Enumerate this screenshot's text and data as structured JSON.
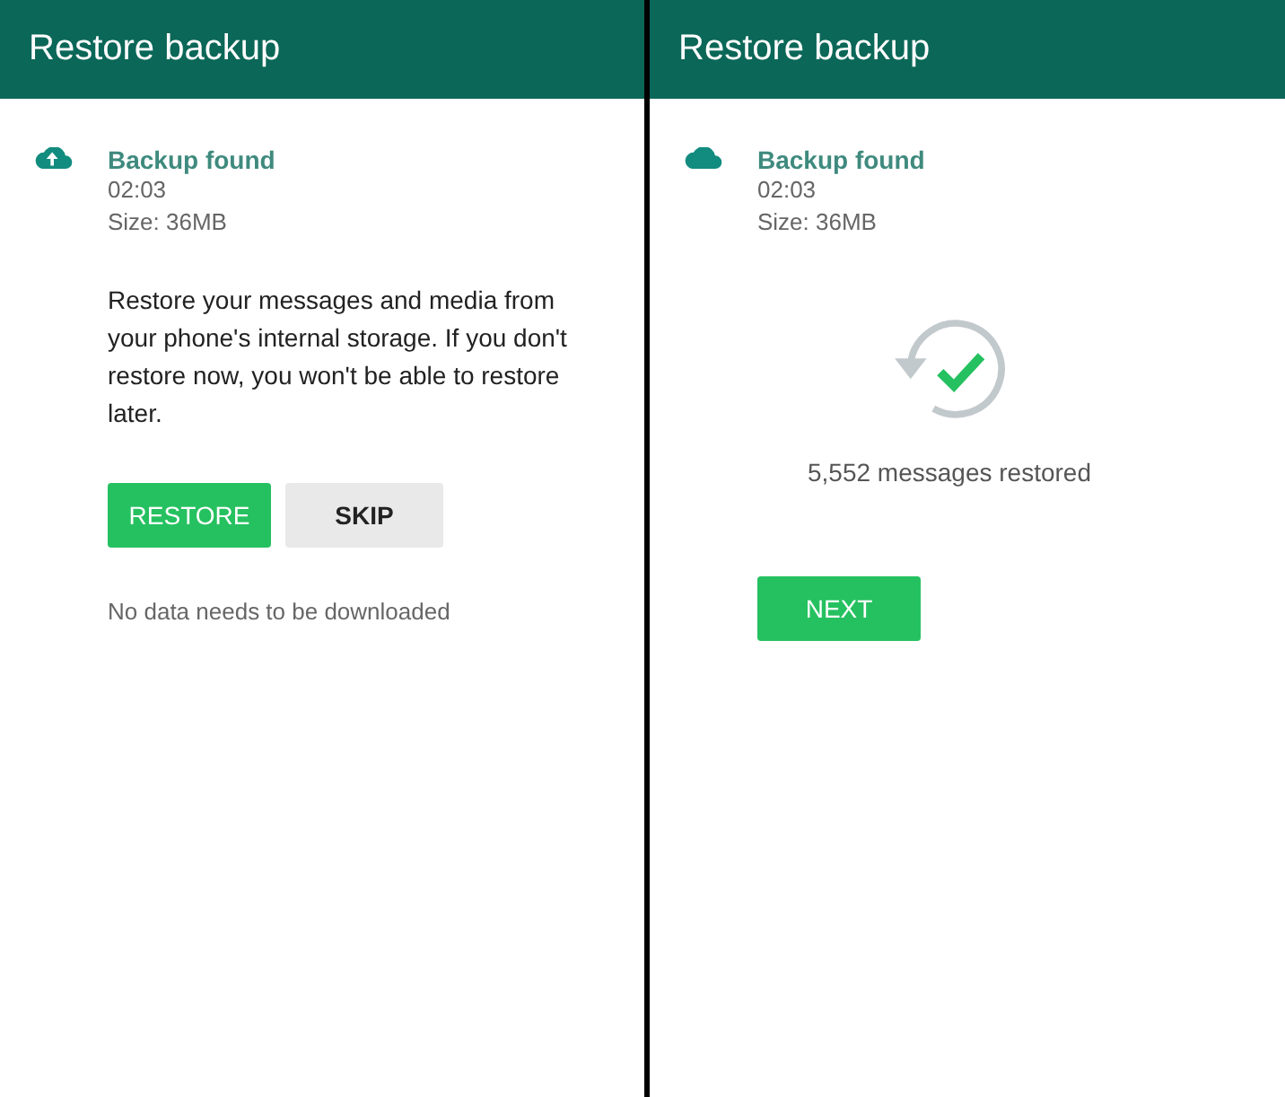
{
  "screens": [
    {
      "title": "Restore backup",
      "backup": {
        "heading": "Backup found",
        "time": "02:03",
        "size": "Size: 36MB",
        "cloud_arrow": true
      },
      "message": "Restore your messages and media from your phone's internal storage. If you don't restore now, you won't be able to restore later.",
      "buttons": [
        {
          "label": "RESTORE",
          "kind": "primary"
        },
        {
          "label": "SKIP",
          "kind": "secondary"
        }
      ],
      "note": "No data needs to be downloaded"
    },
    {
      "title": "Restore backup",
      "backup": {
        "heading": "Backup found",
        "time": "02:03",
        "size": "Size: 36MB",
        "cloud_arrow": false
      },
      "status": "5,552 messages restored",
      "buttons": [
        {
          "label": "NEXT",
          "kind": "primary"
        }
      ]
    }
  ]
}
